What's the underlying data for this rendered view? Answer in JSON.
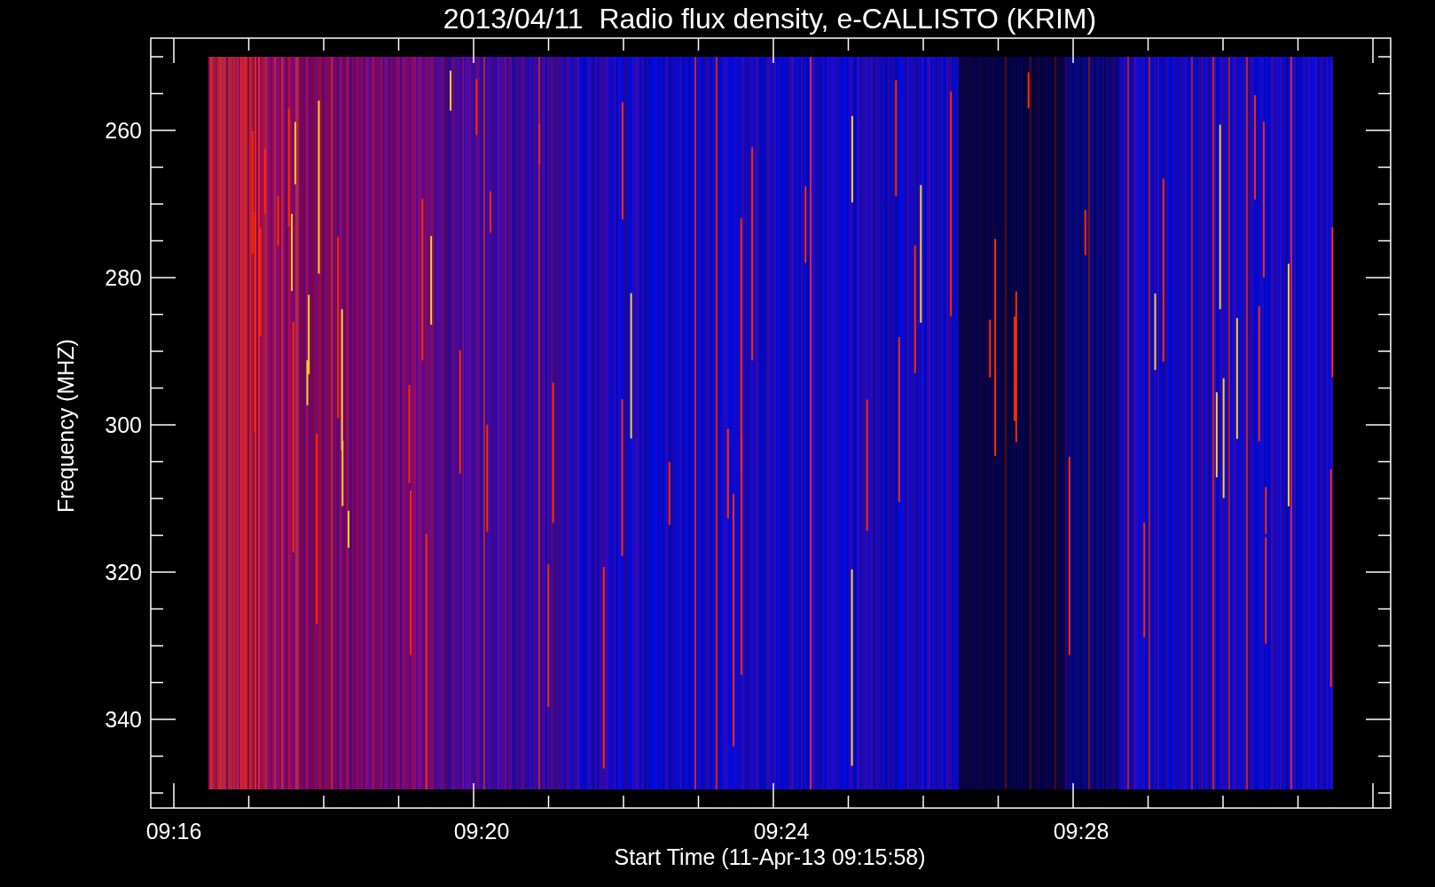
{
  "title": "2013/04/11  Radio flux density, e-CALLISTO (KRIM)",
  "y_axis": {
    "label": "Frequency (MHZ)",
    "ticks": [
      "260",
      "280",
      "300",
      "320",
      "340"
    ]
  },
  "x_axis": {
    "label": "Start Time (11-Apr-13 09:15:58)",
    "ticks": [
      "09:16",
      "09:20",
      "09:24",
      "09:28"
    ]
  }
}
